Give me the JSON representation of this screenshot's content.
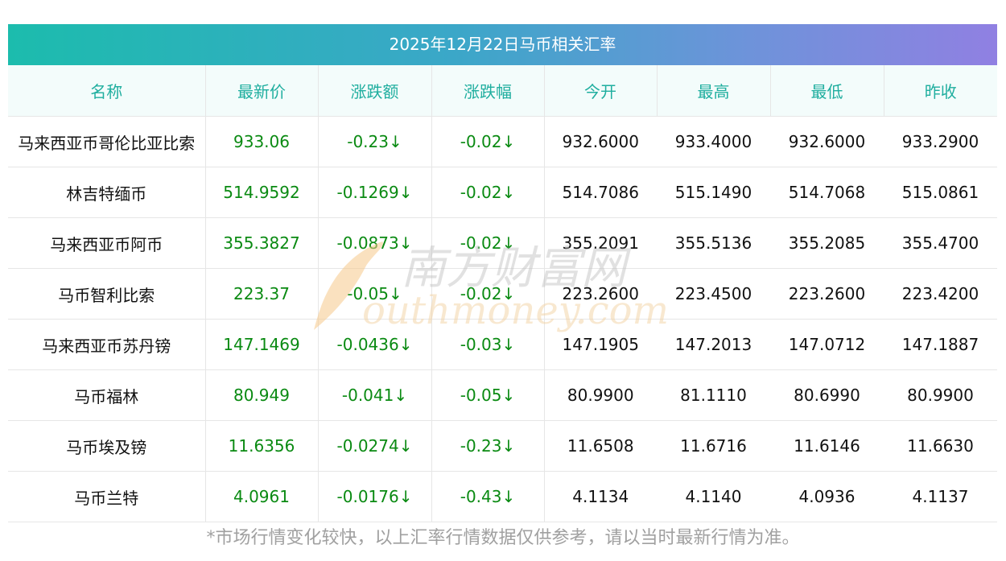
{
  "title": "2025年12月22日马币相关汇率",
  "headers": [
    "名称",
    "最新价",
    "涨跌额",
    "涨跌幅",
    "今开",
    "最高",
    "最低",
    "昨收"
  ],
  "rows": [
    {
      "name": "马来西亚币哥伦比亚比索",
      "price": "933.06",
      "change": "-0.23↓",
      "pct": "-0.02↓",
      "open": "932.6000",
      "high": "933.4000",
      "low": "932.6000",
      "prev": "933.2900"
    },
    {
      "name": "林吉特缅币",
      "price": "514.9592",
      "change": "-0.1269↓",
      "pct": "-0.02↓",
      "open": "514.7086",
      "high": "515.1490",
      "low": "514.7068",
      "prev": "515.0861"
    },
    {
      "name": "马来西亚币阿币",
      "price": "355.3827",
      "change": "-0.0873↓",
      "pct": "-0.02↓",
      "open": "355.2091",
      "high": "355.5136",
      "low": "355.2085",
      "prev": "355.4700"
    },
    {
      "name": "马币智利比索",
      "price": "223.37",
      "change": "-0.05↓",
      "pct": "-0.02↓",
      "open": "223.2600",
      "high": "223.4500",
      "low": "223.2600",
      "prev": "223.4200"
    },
    {
      "name": "马来西亚币苏丹镑",
      "price": "147.1469",
      "change": "-0.0436↓",
      "pct": "-0.03↓",
      "open": "147.1905",
      "high": "147.2013",
      "low": "147.0712",
      "prev": "147.1887"
    },
    {
      "name": "马币福林",
      "price": "80.949",
      "change": "-0.041↓",
      "pct": "-0.05↓",
      "open": "80.9900",
      "high": "81.1110",
      "low": "80.6990",
      "prev": "80.9900"
    },
    {
      "name": "马币埃及镑",
      "price": "11.6356",
      "change": "-0.0274↓",
      "pct": "-0.23↓",
      "open": "11.6508",
      "high": "11.6716",
      "low": "11.6146",
      "prev": "11.6630"
    },
    {
      "name": "马币兰特",
      "price": "4.0961",
      "change": "-0.0176↓",
      "pct": "-0.43↓",
      "open": "4.1134",
      "high": "4.1140",
      "low": "4.0936",
      "prev": "4.1137"
    }
  ],
  "footnote": "*市场行情变化较快，以上汇率行情数据仅供参考，请以当时最新行情为准。",
  "watermark": {
    "cn": "南方财富网",
    "en": "outhmoney.com"
  },
  "colors": {
    "header_text": "#1fae9f",
    "down": "#0a8a12",
    "gradient_start": "#1cbcad",
    "gradient_end": "#9080e2"
  }
}
